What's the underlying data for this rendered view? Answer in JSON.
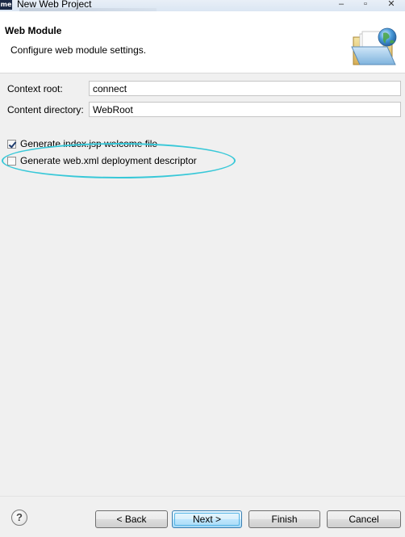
{
  "window": {
    "title": "New Web Project",
    "app_icon_text": "me"
  },
  "banner": {
    "title": "Web Module",
    "description": "Configure web module settings."
  },
  "form": {
    "context_root": {
      "label": "Context root:",
      "value": "connect"
    },
    "content_directory": {
      "label": "Content directory:",
      "value": "WebRoot"
    }
  },
  "options": {
    "generate_index_jsp": {
      "label": "Generate index.jsp welcome file",
      "checked": true
    },
    "generate_web_xml": {
      "label": "Generate web.xml deployment descriptor",
      "checked": false
    }
  },
  "footer": {
    "help": "?",
    "back_label": "< Back",
    "next_label": "Next >",
    "finish_label": "Finish",
    "cancel_label": "Cancel"
  },
  "colors": {
    "highlight_ellipse": "#38c8d8",
    "default_button_border": "#3c7fb1",
    "banner_bg": "#ffffff",
    "dialog_bg": "#f0f0f0"
  }
}
